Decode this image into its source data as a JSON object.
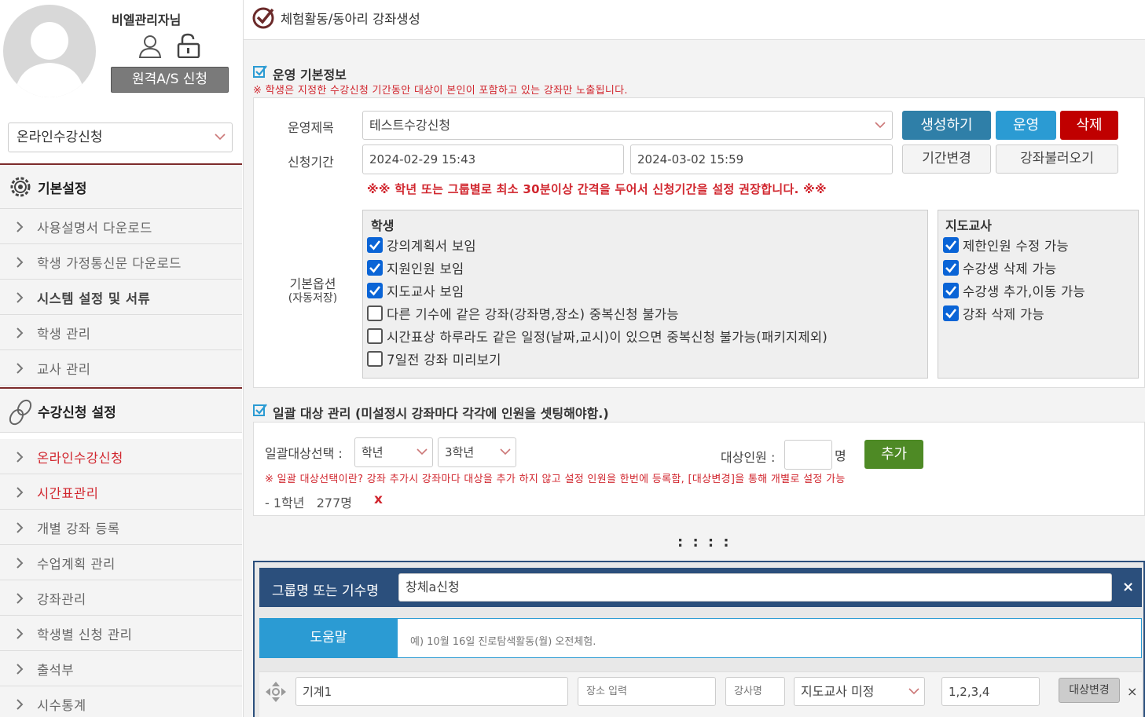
{
  "sidebar": {
    "user_name": "비엘관리자님",
    "remote_btn": "원격A/S 신청",
    "course_select": "온라인수강신청",
    "sections": [
      {
        "label": "기본설정",
        "icon": "gear-icon"
      },
      {
        "label": "수강신청 설정",
        "icon": "link-icon"
      }
    ],
    "items1": [
      "사용설명서 다운로드",
      "학생 가정통신문 다운로드",
      "시스템 설정 및 서류",
      "학생 관리",
      "교사 관리"
    ],
    "items2": [
      "온라인수강신청",
      "시간표관리",
      "개별 강좌 등록",
      "수업계획 관리",
      "강좌관리",
      "학생별 신청 관리",
      "출석부",
      "시수통계"
    ]
  },
  "header": {
    "title": "체험활동/동아리 강좌생성"
  },
  "basic": {
    "title": "운영 기본정보",
    "notice": "※ 학생은 지정한 수강신청 기간동안 대상이 본인이 포함하고 있는 강좌만 노출됩니다.",
    "name_label": "운영제목",
    "name_value": "테스트수강신청",
    "period_label": "신청기간",
    "start": "2024-02-29 15:43",
    "end": "2024-03-02 15:59",
    "period_notice_pre": "※※ 학년 또는 그룹별로 최소 ",
    "period_notice_bold": "30분이상",
    "period_notice_post": " 간격을 두어서 신청기간을 설정 권장합니다. ※※",
    "btn_create": "생성하기",
    "btn_run": "운영",
    "btn_delete": "삭제",
    "btn_change_period": "기간변경",
    "btn_load": "강좌불러오기",
    "options_label": "기본옵션",
    "options_sub": "(자동저장)",
    "student_title": "학생",
    "student_opts": [
      {
        "label": "강의계획서 보임",
        "checked": true
      },
      {
        "label": "지원인원 보임",
        "checked": true
      },
      {
        "label": "지도교사 보임",
        "checked": true
      },
      {
        "label": "다른 기수에 같은 강좌(강좌명,장소) 중복신청 불가능",
        "checked": false
      },
      {
        "label": "시간표상 하루라도 같은 일정(날짜,교시)이 있으면 중복신청 불가능(패키지제외)",
        "checked": false
      },
      {
        "label": "7일전 강좌 미리보기",
        "checked": false
      }
    ],
    "teacher_title": "지도교사",
    "teacher_opts": [
      {
        "label": "제한인원 수정 가능",
        "checked": true
      },
      {
        "label": "수강생 삭제 가능",
        "checked": true
      },
      {
        "label": "수강생 추가,이동 가능",
        "checked": true
      },
      {
        "label": "강좌 삭제 가능",
        "checked": true
      }
    ]
  },
  "bulk": {
    "title": "일괄 대상 관리 (미설정시 강좌마다 각각에 인원을 셋팅해야함.)",
    "select_label": "일괄대상선택 :",
    "sel1": "학년",
    "sel2": "3학년",
    "count_label": "대상인원 :",
    "count_unit": "명",
    "btn_add": "추가",
    "notice": "※ 일괄 대상선택이란? 강좌 추가시 강좌마다 대상을 추가 하지 않고 설정 인원을 한번에 등록함, [대상변경]을 통해 개별로 설정 가능",
    "entry": "- 1학년   277명",
    "entry_remove": "x",
    "divider": ": : : :"
  },
  "group": {
    "label": "그룹명 또는 기수명",
    "value": "창체a신청",
    "close": "×",
    "help_label": "도움말",
    "help_text": "예) 10월 16일 진로탐색활동(월) 오전체험.",
    "row": {
      "name": "기계1",
      "place_placeholder": "장소 입력",
      "teacher_placeholder": "강사명",
      "teacher_select": "지도교사 미정",
      "periods": "1,2,3,4",
      "btn_target": "대상변경",
      "remove": "×"
    }
  },
  "colors": {
    "create": "#2f7fa8",
    "run": "#2b9bd3",
    "delete": "#c00000",
    "add": "#4e8a25",
    "accent_red": "#d1262e",
    "group": "#2b4f7c"
  }
}
